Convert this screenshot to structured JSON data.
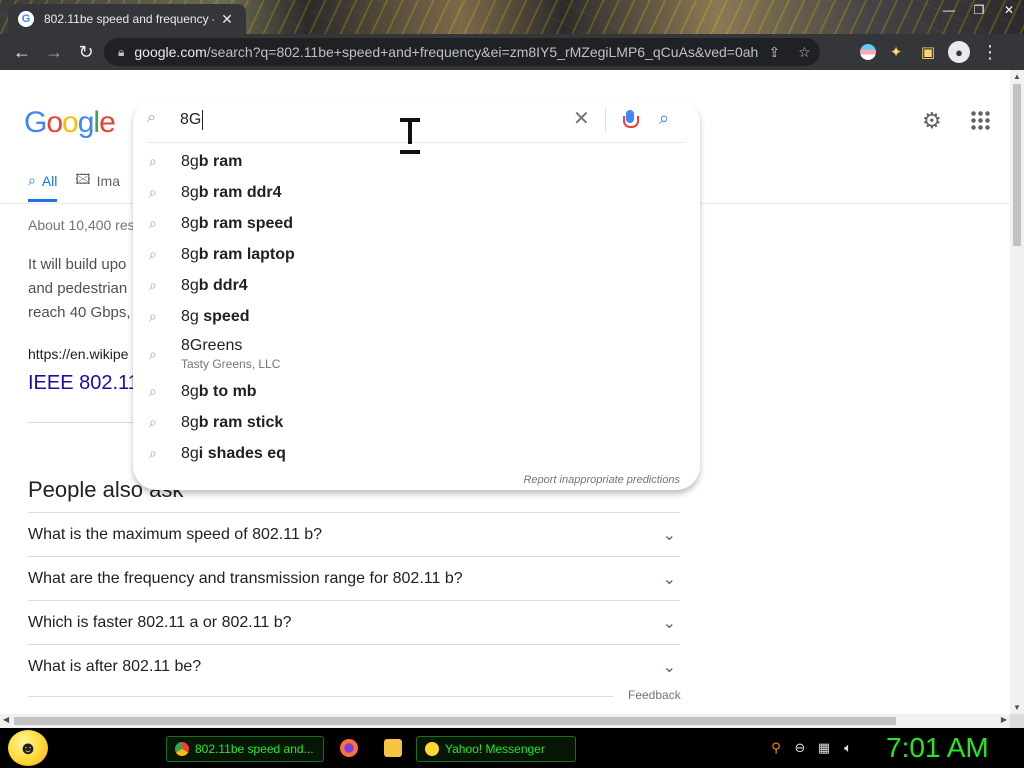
{
  "browser": {
    "tab_title": "802.11be speed and frequency -",
    "tab_favicon": "G",
    "url_host": "google.com",
    "url_path": "/search?q=802.11be+speed+and+frequency&ei=zm8IY5_rMZegiLMP6_qCuAs&ved=0ah...",
    "window_controls": [
      "—",
      "❐",
      "✕"
    ]
  },
  "google": {
    "logo": [
      "G",
      "o",
      "o",
      "g",
      "l",
      "e"
    ],
    "search_value": "8G",
    "tabs": [
      {
        "label": "All",
        "icon": "search-icon",
        "active": true
      },
      {
        "label": "Ima",
        "icon": "image-icon",
        "active": false
      }
    ],
    "stats": "About 10,400 res",
    "snippet_lines": [
      "It will build upo",
      "and pedestrian",
      "reach 40 Gbps,"
    ],
    "cite": "https://en.wikipe",
    "result_title": "IEEE 802.11",
    "report": "Report inappropriate predictions",
    "suggestions": [
      {
        "pre": "8g",
        "post": "b ram"
      },
      {
        "pre": "8g",
        "post": "b ram ddr4"
      },
      {
        "pre": "8g",
        "post": "b ram speed"
      },
      {
        "pre": "8g",
        "post": "b ram laptop"
      },
      {
        "pre": "8g",
        "post": "b ddr4"
      },
      {
        "pre": "8g",
        "post": " speed"
      },
      {
        "pre": "8Greens",
        "post": "",
        "sub": "Tasty Greens, LLC"
      },
      {
        "pre": "8g",
        "post": "b to mb"
      },
      {
        "pre": "8g",
        "post": "b ram stick"
      },
      {
        "pre": "8g",
        "post": "i shades eq"
      }
    ],
    "paa_title": "People also ask",
    "paa_questions": [
      "What is the maximum speed of 802.11 b?",
      "What are the frequency and transmission range for 802.11 b?",
      "Which is faster 802.11 a or 802.11 b?",
      "What is after 802.11 be?"
    ],
    "feedback": "Feedback"
  },
  "taskbar": {
    "chrome_label": "802.11be speed and...",
    "yahoo_label": "Yahoo! Messenger",
    "clock": "7:01 AM"
  },
  "colors": {
    "accent": "#1a73e8",
    "link": "#1a0dab",
    "taskbar_text": "#25e825"
  }
}
